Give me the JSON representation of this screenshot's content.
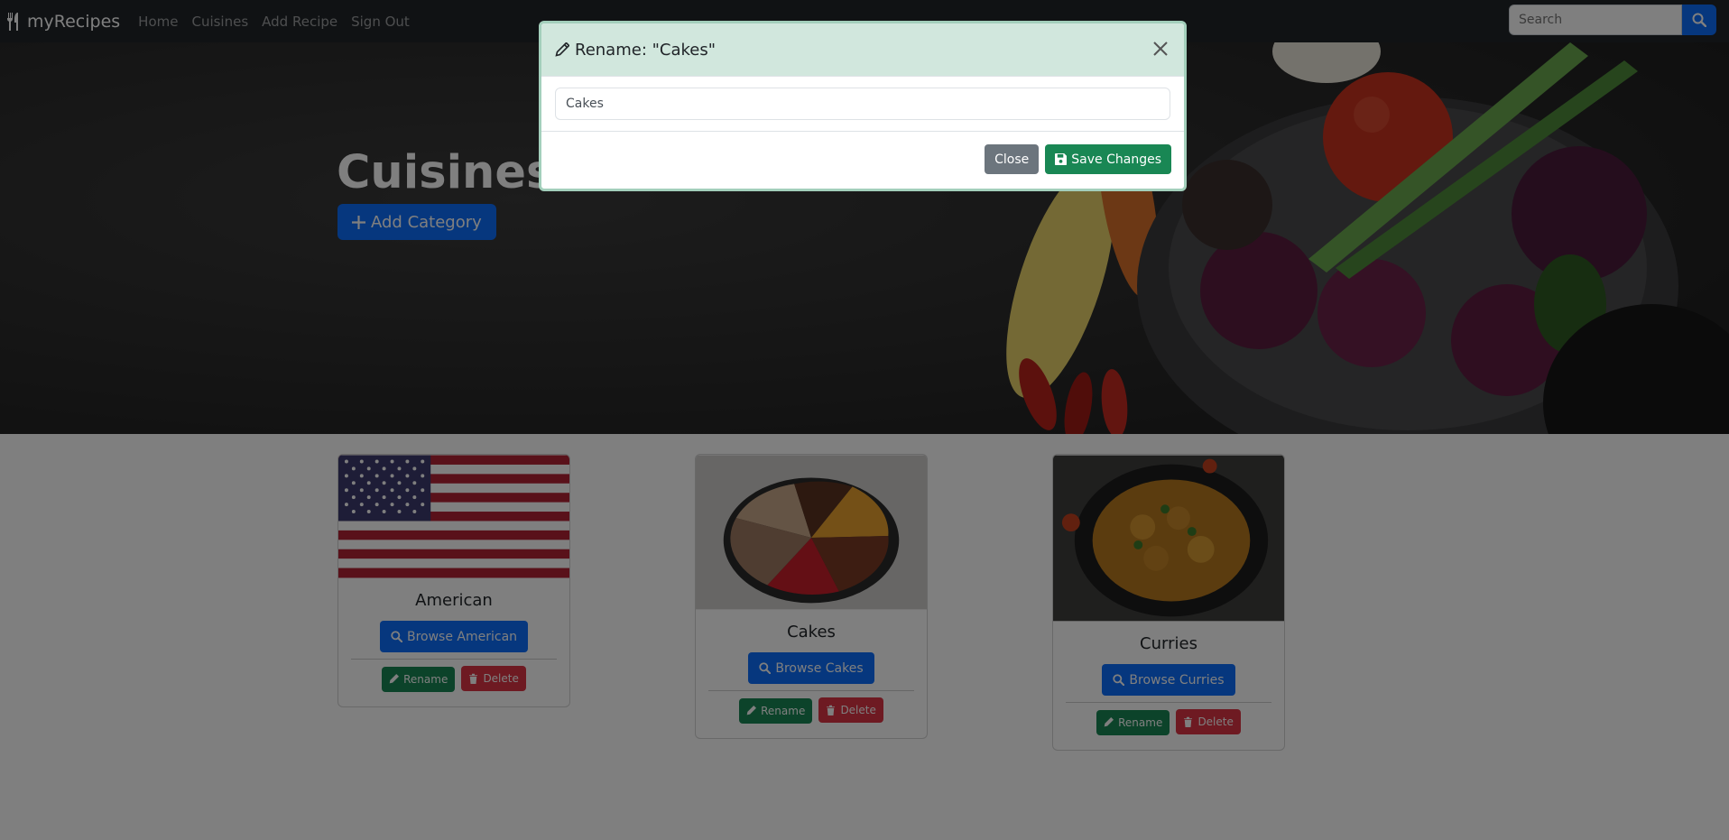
{
  "navbar": {
    "brand": "myRecipes",
    "links": [
      "Home",
      "Cuisines",
      "Add Recipe",
      "Sign Out"
    ],
    "search_placeholder": "Search"
  },
  "hero": {
    "title": "Cuisines",
    "add_category_label": "Add Category"
  },
  "cards": [
    {
      "title": "American",
      "browse_label": "Browse American",
      "rename_label": "Rename",
      "delete_label": "Delete"
    },
    {
      "title": "Cakes",
      "browse_label": "Browse Cakes",
      "rename_label": "Rename",
      "delete_label": "Delete"
    },
    {
      "title": "Curries",
      "browse_label": "Browse Curries",
      "rename_label": "Rename",
      "delete_label": "Delete"
    }
  ],
  "modal": {
    "title": "Rename: \"Cakes\"",
    "input_value": "Cakes",
    "close_label": "Close",
    "save_label": "Save Changes"
  },
  "colors": {
    "primary": "#0d6efd",
    "success": "#198754",
    "danger": "#dc3545",
    "secondary": "#6c757d",
    "modal_header": "#d1e7dd"
  },
  "icons": {
    "brand": "utensils-icon",
    "search": "search-icon",
    "add": "plus-icon",
    "browse": "search-icon",
    "rename": "pencil-icon",
    "delete": "trash-icon",
    "modal_title": "pencil-icon",
    "close": "close-icon",
    "save": "floppy-disk-icon"
  }
}
